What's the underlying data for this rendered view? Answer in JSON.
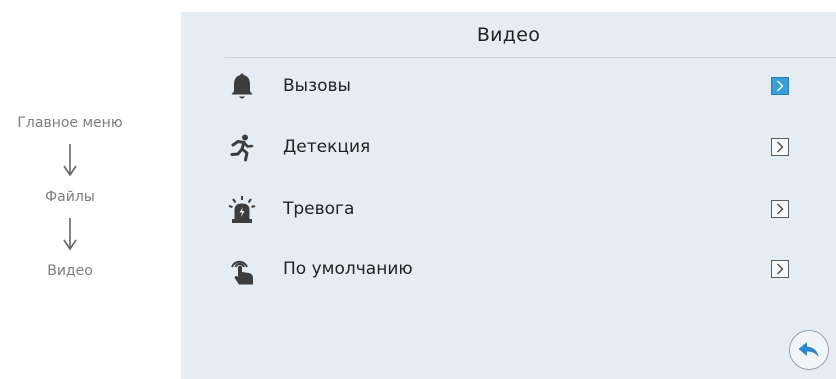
{
  "breadcrumb": {
    "items": [
      "Главное меню",
      "Файлы",
      "Видео"
    ]
  },
  "screen": {
    "title": "Видео"
  },
  "menu": {
    "items": [
      {
        "label": "Вызовы",
        "icon": "bell-icon",
        "selected": true
      },
      {
        "label": "Детекция",
        "icon": "running-person-icon",
        "selected": false
      },
      {
        "label": "Тревога",
        "icon": "alarm-siren-icon",
        "selected": false
      },
      {
        "label": "По умолчанию",
        "icon": "hand-tap-icon",
        "selected": false
      }
    ]
  },
  "back_button": {
    "icon": "back-arrow-icon"
  },
  "colors": {
    "panel_bg": "#e6edf2",
    "accent_selected": "#3a9fd9",
    "icon_dark": "#3d3d3d",
    "muted_text": "#7d7d7d"
  }
}
